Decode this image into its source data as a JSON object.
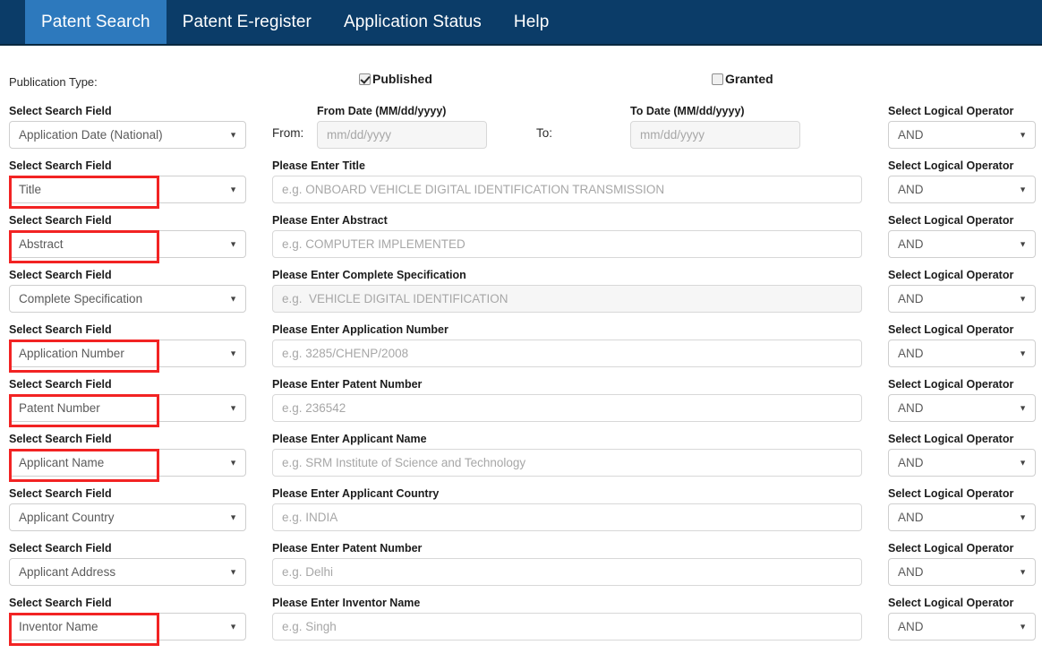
{
  "nav": {
    "tabs": [
      {
        "label": "Patent Search",
        "active": true
      },
      {
        "label": "Patent E-register",
        "active": false
      },
      {
        "label": "Application Status",
        "active": false
      },
      {
        "label": "Help",
        "active": false
      }
    ]
  },
  "publication": {
    "label": "Publication Type:",
    "published": {
      "label": "Published",
      "checked": true
    },
    "granted": {
      "label": "Granted",
      "checked": false
    }
  },
  "labels": {
    "search_field": "Select Search Field",
    "logical_operator": "Select Logical Operator",
    "caret": "chevron-down-icon"
  },
  "date_row": {
    "from_prefix": "From:",
    "from_heading": "From Date (MM/dd/yyyy)",
    "from_placeholder": "mm/dd/yyyy",
    "from_value": "",
    "to_prefix": "To:",
    "to_heading": "To Date (MM/dd/yyyy)",
    "to_placeholder": "mm/dd/yyyy",
    "to_value": "",
    "search_field": "Application Date (National)",
    "logical_operator": "AND",
    "marked": false
  },
  "rows": [
    {
      "search_field": "Title",
      "marked": true,
      "input_label": "Please Enter Title",
      "placeholder": "e.g. ONBOARD VEHICLE DIGITAL IDENTIFICATION TRANSMISSION",
      "value": "",
      "dim": false,
      "logical_operator": "AND"
    },
    {
      "search_field": "Abstract",
      "marked": true,
      "input_label": "Please Enter Abstract",
      "placeholder": "e.g. COMPUTER IMPLEMENTED",
      "value": "",
      "dim": false,
      "logical_operator": "AND"
    },
    {
      "search_field": "Complete Specification",
      "marked": false,
      "input_label": "Please Enter Complete Specification",
      "placeholder": "e.g.  VEHICLE DIGITAL IDENTIFICATION",
      "value": "",
      "dim": true,
      "logical_operator": "AND"
    },
    {
      "search_field": "Application Number",
      "marked": true,
      "input_label": "Please Enter Application Number",
      "placeholder": "e.g. 3285/CHENP/2008",
      "value": "",
      "dim": false,
      "logical_operator": "AND"
    },
    {
      "search_field": "Patent Number",
      "marked": true,
      "input_label": "Please Enter Patent Number",
      "placeholder": "e.g. 236542",
      "value": "",
      "dim": false,
      "logical_operator": "AND"
    },
    {
      "search_field": "Applicant Name",
      "marked": true,
      "input_label": "Please Enter Applicant Name",
      "placeholder": "e.g. SRM Institute of Science and Technology",
      "value": "",
      "dim": false,
      "logical_operator": "AND"
    },
    {
      "search_field": "Applicant Country",
      "marked": false,
      "input_label": "Please Enter Applicant Country",
      "placeholder": "e.g. INDIA",
      "value": "",
      "dim": false,
      "logical_operator": "AND"
    },
    {
      "search_field": "Applicant Address",
      "marked": false,
      "input_label": "Please Enter Patent Number",
      "placeholder": "e.g. Delhi",
      "value": "",
      "dim": false,
      "logical_operator": "AND"
    },
    {
      "search_field": "Inventor Name",
      "marked": true,
      "input_label": "Please Enter Inventor Name",
      "placeholder": "e.g. Singh",
      "value": "",
      "dim": false,
      "logical_operator": "AND"
    }
  ],
  "colors": {
    "navbar_bg": "#0b3c68",
    "active_tab_bg": "#2d79bd",
    "annotation_red": "#f22323"
  }
}
